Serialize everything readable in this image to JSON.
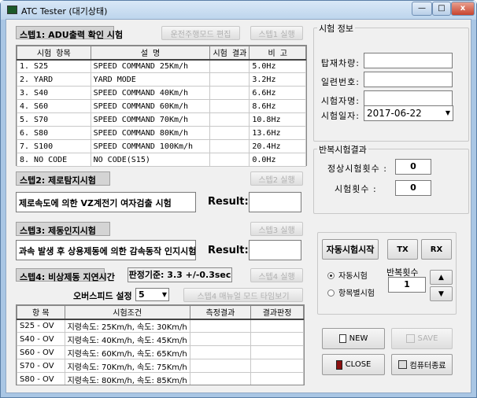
{
  "window": {
    "title": "ATC Tester (대기상태)",
    "minimize": "—",
    "maximize": "□",
    "close": "x"
  },
  "step1": {
    "label": "스텝1: ADU출력 확인 시험",
    "edit_button": "운전주행모드 편집",
    "run_button": "스텝1 실행",
    "columns": [
      "시험 항목",
      "설 명",
      "시험 결과",
      "비 고"
    ],
    "rows": [
      [
        "1. S25",
        "SPEED COMMAND 25Km/h",
        "",
        "5.0Hz"
      ],
      [
        "2. YARD",
        "YARD MODE",
        "",
        "3.2Hz"
      ],
      [
        "3. S40",
        "SPEED COMMAND 40Km/h",
        "",
        "6.6Hz"
      ],
      [
        "4. S60",
        "SPEED COMMAND 60Km/h",
        "",
        "8.6Hz"
      ],
      [
        "5. S70",
        "SPEED COMMAND 70Km/h",
        "",
        "10.8Hz"
      ],
      [
        "6. S80",
        "SPEED COMMAND 80Km/h",
        "",
        "13.6Hz"
      ],
      [
        "7. S100",
        "SPEED COMMAND 100Km/h",
        "",
        "20.4Hz"
      ],
      [
        "8. NO CODE",
        "NO CODE(S15)",
        "",
        "0.0Hz"
      ]
    ]
  },
  "step2": {
    "label": "스텝2: 제로탐지시험",
    "run_button": "스텝2 실행",
    "description": "제로속도에 의한 VZ계전기 여자검출 시험",
    "result_label": "Result:",
    "result_value": ""
  },
  "step3": {
    "label": "스텝3: 제동인지시험",
    "run_button": "스텝3 실행",
    "description": "과속 발생 후 상용제동에 의한 감속동작 인지시험",
    "result_label": "Result:",
    "result_value": ""
  },
  "step4": {
    "label": "스텝4: 비상제동 지연시간",
    "criteria": "판정기준: 3.3 +/-0.3sec",
    "run_button": "스텝4 실행",
    "overspeed_label": "오버스피드 설정 :",
    "overspeed_value": "5",
    "manual_button": "스텝4 매뉴얼 모드 타임보기",
    "columns": [
      "항 목",
      "시험조건",
      "측정결과",
      "결과판정"
    ],
    "rows": [
      [
        "S25 - OV",
        "지령속도: 25Km/h, 속도: 30Km/h",
        "",
        ""
      ],
      [
        "S40 - OV",
        "지령속도: 40Km/h, 속도: 45Km/h",
        "",
        ""
      ],
      [
        "S60 - OV",
        "지령속도: 60Km/h, 속도: 65Km/h",
        "",
        ""
      ],
      [
        "S70 - OV",
        "지령속도: 70Km/h, 속도: 75Km/h",
        "",
        ""
      ],
      [
        "S80 - OV",
        "지령속도: 80Km/h, 속도: 85Km/h",
        "",
        ""
      ]
    ]
  },
  "info": {
    "title": "시험 정보",
    "vehicle_label": "탑재차량:",
    "vehicle_value": "",
    "serial_label": "일련번호:",
    "serial_value": "",
    "tester_label": "시험자명:",
    "tester_value": "",
    "date_label": "시험일자:",
    "date_value": "2017-06-22"
  },
  "repeat_result": {
    "title": "반복시험결과",
    "normal_label": "정상시험횟수  :",
    "normal_value": "0",
    "count_label": "시험횟수   :",
    "count_value": "0"
  },
  "control": {
    "start_button": "자동시험시작",
    "tx_button": "TX",
    "rx_button": "RX",
    "radio_auto": "자동시험",
    "radio_item": "항목별시험",
    "repeat_label": "반복횟수",
    "repeat_value": "1",
    "selected_mode": "자동시험"
  },
  "actions": {
    "new": "NEW",
    "save": "SAVE",
    "close": "CLOSE",
    "shutdown": "컴퓨터종료"
  }
}
